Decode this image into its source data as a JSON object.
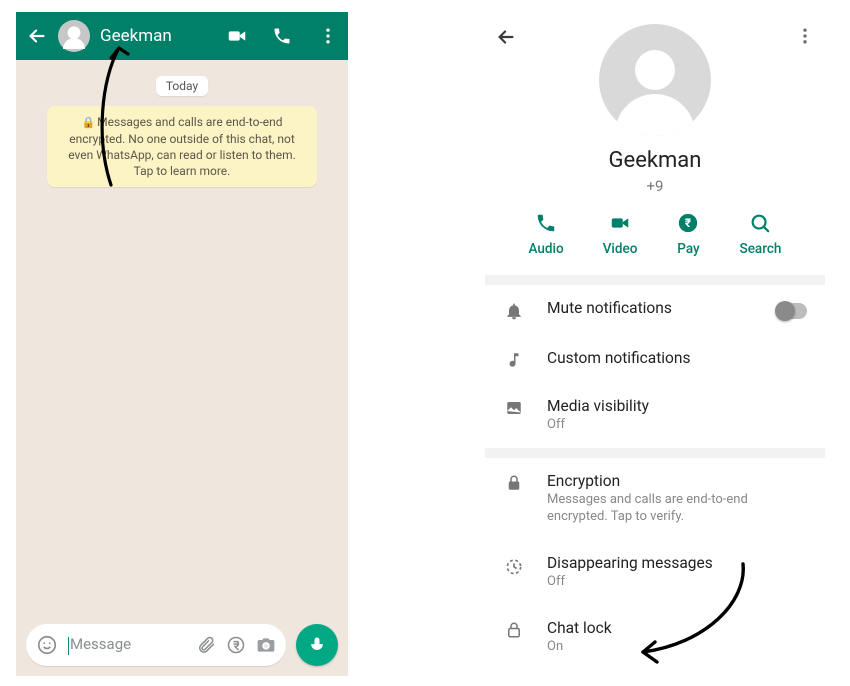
{
  "chat": {
    "contact_name": "Geekman",
    "date_label": "Today",
    "e2e_notice": "Messages and calls are end-to-end encrypted. No one outside of this chat, not even WhatsApp, can read or listen to them. Tap to learn more.",
    "input_placeholder": "Message"
  },
  "info": {
    "name": "Geekman",
    "phone": "+9",
    "actions": {
      "audio": "Audio",
      "video": "Video",
      "pay": "Pay",
      "search": "Search"
    },
    "rows": {
      "mute": {
        "title": "Mute notifications"
      },
      "custom": {
        "title": "Custom notifications"
      },
      "media": {
        "title": "Media visibility",
        "sub": "Off"
      },
      "enc": {
        "title": "Encryption",
        "sub": "Messages and calls are end-to-end encrypted. Tap to verify."
      },
      "disap": {
        "title": "Disappearing messages",
        "sub": "Off"
      },
      "lock": {
        "title": "Chat lock",
        "sub": "On"
      }
    }
  }
}
